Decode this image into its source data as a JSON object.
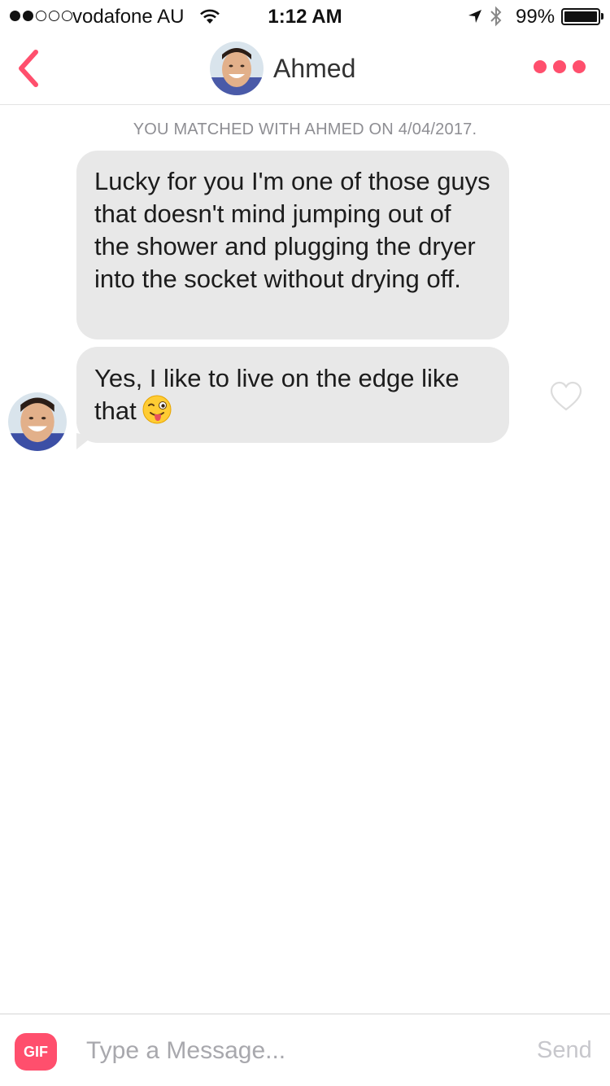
{
  "status_bar": {
    "carrier": "vodafone AU",
    "time": "1:12 AM",
    "battery_pct": "99%",
    "signal_bars_filled": 2,
    "signal_bars_total": 5
  },
  "header": {
    "name": "Ahmed",
    "back_icon": "chevron-left-icon",
    "more_icon": "more-dots-icon",
    "accent_color": "#ff4f6d"
  },
  "chat": {
    "match_note": "YOU MATCHED WITH AHMED ON 4/04/2017.",
    "messages": [
      {
        "text": "Lucky for you I'm one of those guys that doesn't mind jumping out of the shower and plugging the dryer into the socket without drying off."
      },
      {
        "text": "Yes, I like to live on the edge like that",
        "emoji": "winking-tongue-face"
      }
    ],
    "bubble_color": "#e8e8e8"
  },
  "composer": {
    "gif_label": "GIF",
    "placeholder": "Type a Message...",
    "value": "",
    "send_label": "Send"
  }
}
